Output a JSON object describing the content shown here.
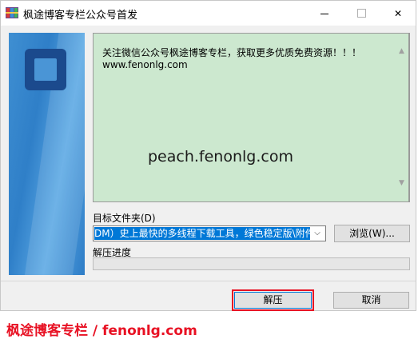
{
  "window": {
    "title": "枫途博客专栏公众号首发",
    "minimize_symbol": "",
    "close_symbol": "✕"
  },
  "message": {
    "line1": "关注微信公众号枫途博客专栏，获取更多优质免费资源！！！",
    "line2": "www.fenonlg.com",
    "watermark": "peach.fenonlg.com"
  },
  "destination": {
    "label": "目标文件夹(D)",
    "value": "DM）史上最快的多线程下载工具，绿色稳定版\\附件",
    "browse_label": "浏览(W)..."
  },
  "progress": {
    "label": "解压进度",
    "value": 0
  },
  "buttons": {
    "extract_label": "解压",
    "cancel_label": "取消"
  },
  "footer": {
    "text": "枫途博客专栏 / fenonlg.com"
  },
  "colors": {
    "text_background": "#cce8cf",
    "selection": "#0078d7",
    "footer": "#e81123",
    "highlight_frame": "#e81123"
  },
  "icons": {
    "app": "archive-icon",
    "dropdown": "chevron-down-icon",
    "scroll_up": "scroll-up-icon",
    "scroll_down": "scroll-down-icon"
  }
}
